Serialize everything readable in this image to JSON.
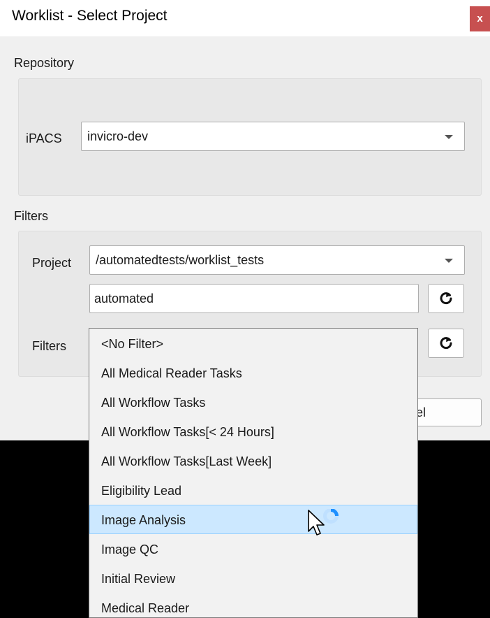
{
  "window": {
    "title": "Worklist - Select Project",
    "close_label": "x"
  },
  "repository": {
    "section_label": "Repository",
    "ipacs_label": "iPACS",
    "ipacs_value": "invicro-dev"
  },
  "filters": {
    "section_label": "Filters",
    "project_label": "Project",
    "project_value": "/automatedtests/worklist_tests",
    "search_value": "automated",
    "filters_label": "Filters"
  },
  "buttons": {
    "cancel_label": "ancel"
  },
  "dropdown": {
    "items": [
      "<No Filter>",
      "All Medical Reader Tasks",
      "All Workflow Tasks",
      "All Workflow Tasks[< 24 Hours]",
      "All Workflow Tasks[Last Week]",
      "Eligibility Lead",
      "Image Analysis",
      "Image QC",
      "Initial Review",
      "Medical Reader"
    ],
    "selected": "Image Analysis"
  },
  "colors": {
    "close_bg": "#c75050",
    "selection_bg": "#cce8ff",
    "busy_indicator": "#1e90ff"
  },
  "icons": [
    "refresh-icon",
    "close-icon",
    "chevron-down-icon",
    "pointer-cursor-icon",
    "busy-spinner-icon"
  ]
}
